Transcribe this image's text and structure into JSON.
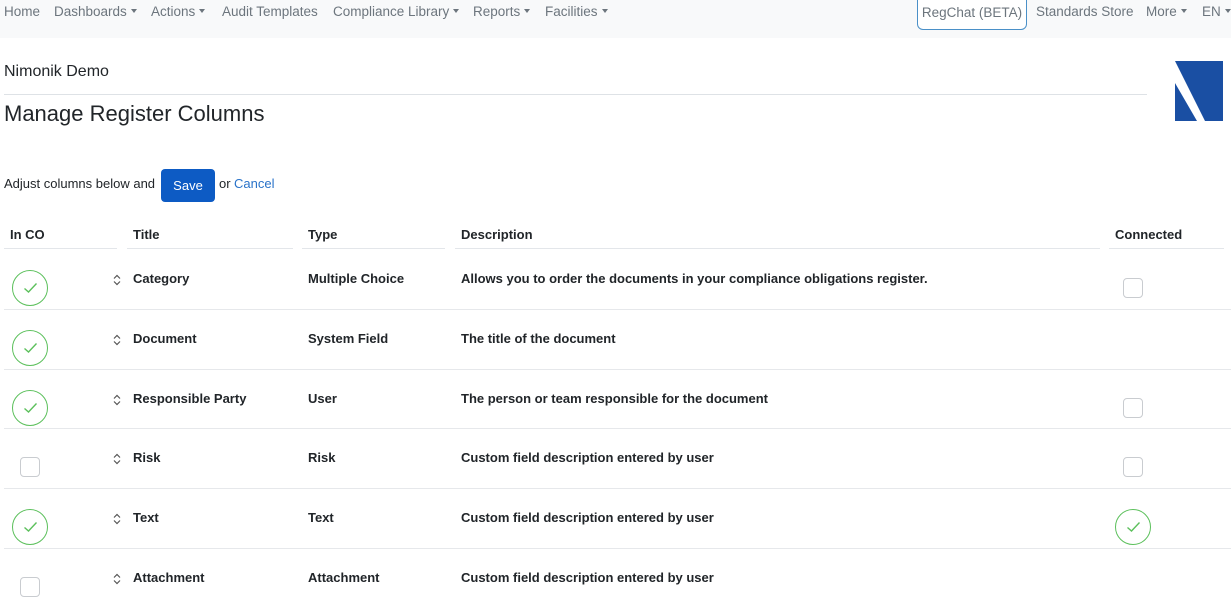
{
  "nav": {
    "home": "Home",
    "dashboards": "Dashboards",
    "actions": "Actions",
    "audit_templates": "Audit Templates",
    "compliance_library": "Compliance Library",
    "reports": "Reports",
    "facilities": "Facilities",
    "regchat": "RegChat (BETA)",
    "standards_store": "Standards Store",
    "more": "More",
    "language": "EN"
  },
  "header": {
    "org_name": "Nimonik Demo",
    "title": "Manage Register Columns"
  },
  "toolbar": {
    "intro": "Adjust columns below and",
    "save_label": "Save",
    "or": "or",
    "cancel_label": "Cancel"
  },
  "table": {
    "headers": {
      "in_co": "In CO",
      "title": "Title",
      "type": "Type",
      "description": "Description",
      "connected": "Connected"
    },
    "rows": [
      {
        "in_co": true,
        "title": "Category",
        "type": "Multiple Choice",
        "description": "Allows you to order the documents in your compliance obligations register.",
        "connected": "unchecked"
      },
      {
        "in_co": true,
        "title": "Document",
        "type": "System Field",
        "description": "The title of the document",
        "connected": "none"
      },
      {
        "in_co": true,
        "title": "Responsible Party",
        "type": "User",
        "description": "The person or team responsible for the document",
        "connected": "unchecked"
      },
      {
        "in_co": false,
        "title": "Risk",
        "type": "Risk",
        "description": "Custom field description entered by user",
        "connected": "unchecked"
      },
      {
        "in_co": true,
        "title": "Text",
        "type": "Text",
        "description": "Custom field description entered by user",
        "connected": "checked"
      },
      {
        "in_co": false,
        "title": "Attachment",
        "type": "Attachment",
        "description": "Custom field description entered by user",
        "connected": "none"
      }
    ]
  },
  "colors": {
    "primary": "#0d5bc4",
    "link": "#2a73c9",
    "check_green": "#5cc05c",
    "logo_blue": "#1a4fa3"
  }
}
